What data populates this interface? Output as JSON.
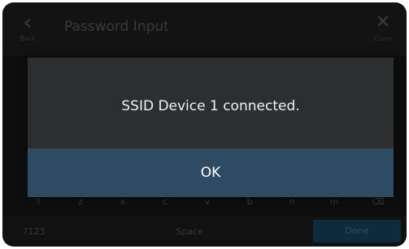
{
  "background": {
    "title": "Password Input",
    "back_label": "Back",
    "close_label": "Close",
    "keys": [
      "⇧",
      "z",
      "x",
      "c",
      "v",
      "b",
      "n",
      "m",
      "⌫"
    ],
    "symbols_key": "?123",
    "space_key": "Space",
    "done_key": "Done"
  },
  "dialog": {
    "message": "SSID Device 1 connected.",
    "ok_label": "OK"
  },
  "colors": {
    "dialog_bg": "#2d2e30",
    "ok_button_bg": "#2f4b63",
    "screen_bg": "#0e0e0f"
  }
}
